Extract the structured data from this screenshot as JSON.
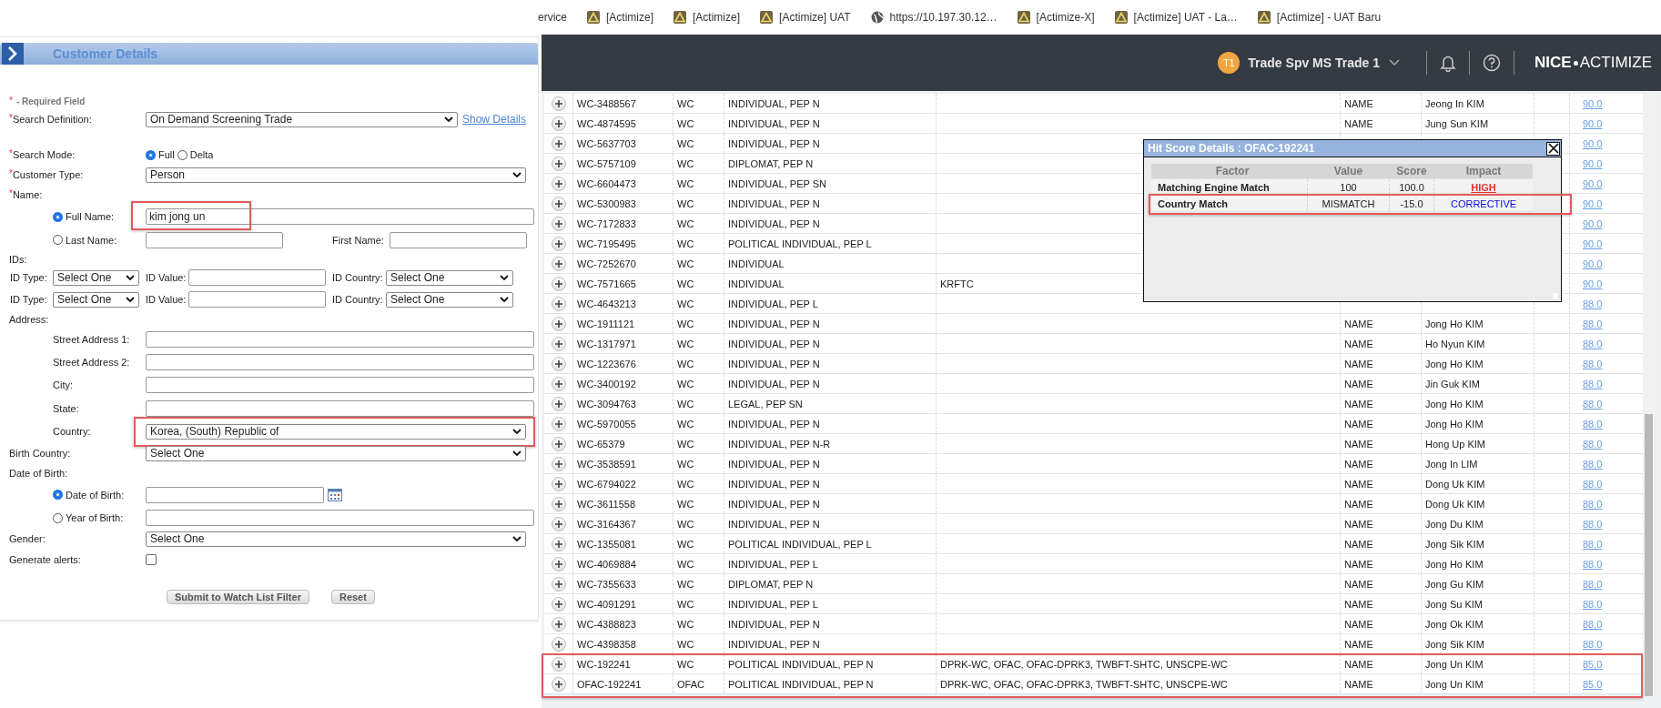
{
  "bookmarks": [
    {
      "label": "ervice"
    },
    {
      "label": "[Actimize]",
      "kind": "triangle"
    },
    {
      "label": "[Actimize]",
      "kind": "triangle"
    },
    {
      "label": "[Actimize] UAT",
      "kind": "triangle"
    },
    {
      "label": "https://10.197.30.12…",
      "kind": "globe"
    },
    {
      "label": "[Actimize-X]",
      "kind": "triangle"
    },
    {
      "label": "[Actimize] UAT - La…",
      "kind": "triangle"
    },
    {
      "label": "[Actimize] - UAT Baru",
      "kind": "triangle"
    }
  ],
  "app_bar": {
    "avatar": "T1",
    "user": "Trade Spv MS Trade 1",
    "logo": {
      "brand": "NICE",
      "product": "ACTIMIZE"
    }
  },
  "customer_details": {
    "title": "Customer Details",
    "required_note": {
      "mark": "*",
      "text": "- Required Field"
    },
    "search_definition": {
      "mark": "*",
      "label": "Search Definition:",
      "value": "On Demand Screening Trade",
      "link": "Show Details"
    },
    "search_mode": {
      "mark": "*",
      "label": "Search Mode:",
      "options": [
        {
          "label": "Full",
          "selected": true
        },
        {
          "label": "Delta",
          "selected": false
        }
      ]
    },
    "customer_type": {
      "mark": "*",
      "label": "Customer Type:",
      "value": "Person"
    },
    "name": {
      "mark": "*",
      "label": "Name:",
      "options": [
        {
          "label": "Full Name:",
          "selected": true,
          "value": "kim jong un",
          "highlighted": true
        },
        {
          "label": "Last Name:",
          "selected": false
        }
      ],
      "first_name": {
        "label": "First Name:"
      }
    },
    "ids": {
      "label": "IDs:",
      "rows": [
        {
          "type_label": "ID Type:",
          "type_value": "Select One",
          "value_label": "ID Value:",
          "country_label": "ID Country:",
          "country_value": "Select One"
        },
        {
          "type_label": "ID Type:",
          "type_value": "Select One",
          "value_label": "ID Value:",
          "country_label": "ID Country:",
          "country_value": "Select One"
        }
      ]
    },
    "address": {
      "label": "Address:",
      "fields": [
        {
          "label": "Street Address 1:",
          "kind": "text"
        },
        {
          "label": "Street Address 2:",
          "kind": "text"
        },
        {
          "label": "City:",
          "kind": "text"
        },
        {
          "label": "State:",
          "kind": "text"
        },
        {
          "label": "Country:",
          "kind": "select",
          "value": "Korea, (South) Republic of",
          "highlighted": true
        }
      ]
    },
    "birth_country": {
      "label": "Birth Country:",
      "value": "Select One"
    },
    "date_of_birth": {
      "label": "Date of Birth:",
      "options": [
        {
          "label": "Date of Birth:",
          "selected": true
        },
        {
          "label": "Year of Birth:",
          "selected": false
        }
      ]
    },
    "gender": {
      "label": "Gender:",
      "value": "Select One"
    },
    "generate_alerts": {
      "label": "Generate alerts:",
      "checked": false
    },
    "buttons": [
      "Submit to Watch List Filter",
      "Reset"
    ]
  },
  "table": {
    "rows": [
      {
        "column_1": "WC-3488567",
        "column_2": "WC",
        "column_3": "INDIVIDUAL, PEP N",
        "column_5": "NAME",
        "column_6": "Jeong In KIM",
        "column_8": "90.0",
        "highlighted": false
      },
      {
        "column_1": "WC-4874595",
        "column_2": "WC",
        "column_3": "INDIVIDUAL, PEP N",
        "column_5": "NAME",
        "column_6": "Jung Sun KIM",
        "column_8": "90.0",
        "highlighted": false
      },
      {
        "column_1": "WC-5637703",
        "column_2": "WC",
        "column_3": "INDIVIDUAL, PEP N",
        "column_8": "90.0",
        "highlighted": false
      },
      {
        "column_1": "WC-5757109",
        "column_2": "WC",
        "column_3": "DIPLOMAT, PEP N",
        "column_8": "90.0",
        "highlighted": false
      },
      {
        "column_1": "WC-6604473",
        "column_2": "WC",
        "column_3": "INDIVIDUAL, PEP SN",
        "column_8": "90.0",
        "highlighted": false
      },
      {
        "column_1": "WC-5300983",
        "column_2": "WC",
        "column_3": "INDIVIDUAL, PEP N",
        "column_8": "90.0",
        "highlighted": false
      },
      {
        "column_1": "WC-7172833",
        "column_2": "WC",
        "column_3": "INDIVIDUAL, PEP N",
        "column_8": "90.0",
        "highlighted": false
      },
      {
        "column_1": "WC-7195495",
        "column_2": "WC",
        "column_3": "POLITICAL INDIVIDUAL, PEP L",
        "column_8": "90.0",
        "highlighted": false
      },
      {
        "column_1": "WC-7252670",
        "column_2": "WC",
        "column_3": "INDIVIDUAL",
        "column_8": "90.0",
        "highlighted": false
      },
      {
        "column_1": "WC-7571665",
        "column_2": "WC",
        "column_3": "INDIVIDUAL",
        "column_4": "KRFTC",
        "column_8": "90.0",
        "highlighted": false
      },
      {
        "column_1": "WC-4643213",
        "column_2": "WC",
        "column_3": "INDIVIDUAL, PEP L",
        "column_8": "88.0",
        "highlighted": false
      },
      {
        "column_1": "WC-1911121",
        "column_2": "WC",
        "column_3": "INDIVIDUAL, PEP N",
        "column_5": "NAME",
        "column_6": "Jong Ho KIM",
        "column_8": "88.0",
        "highlighted": false
      },
      {
        "column_1": "WC-1317971",
        "column_2": "WC",
        "column_3": "INDIVIDUAL, PEP N",
        "column_5": "NAME",
        "column_6": "Ho Nyun KIM",
        "column_8": "88.0",
        "highlighted": false
      },
      {
        "column_1": "WC-1223676",
        "column_2": "WC",
        "column_3": "INDIVIDUAL, PEP N",
        "column_5": "NAME",
        "column_6": "Jong Ho KIM",
        "column_8": "88.0",
        "highlighted": false
      },
      {
        "column_1": "WC-3400192",
        "column_2": "WC",
        "column_3": "INDIVIDUAL, PEP N",
        "column_5": "NAME",
        "column_6": "Jin Guk KIM",
        "column_8": "88.0",
        "highlighted": false
      },
      {
        "column_1": "WC-3094763",
        "column_2": "WC",
        "column_3": "LEGAL, PEP SN",
        "column_5": "NAME",
        "column_6": "Jong Ho KIM",
        "column_8": "88.0",
        "highlighted": false
      },
      {
        "column_1": "WC-5970055",
        "column_2": "WC",
        "column_3": "INDIVIDUAL, PEP N",
        "column_5": "NAME",
        "column_6": "Jong Ho KIM",
        "column_8": "88.0",
        "highlighted": false
      },
      {
        "column_1": "WC-65379",
        "column_2": "WC",
        "column_3": "INDIVIDUAL, PEP N-R",
        "column_5": "NAME",
        "column_6": "Hong Up KIM",
        "column_8": "88.0",
        "highlighted": false
      },
      {
        "column_1": "WC-3538591",
        "column_2": "WC",
        "column_3": "INDIVIDUAL, PEP N",
        "column_5": "NAME",
        "column_6": "Jong In LIM",
        "column_8": "88.0",
        "highlighted": false
      },
      {
        "column_1": "WC-6794022",
        "column_2": "WC",
        "column_3": "INDIVIDUAL, PEP N",
        "column_5": "NAME",
        "column_6": "Dong Uk KIM",
        "column_8": "88.0",
        "highlighted": false
      },
      {
        "column_1": "WC-3611558",
        "column_2": "WC",
        "column_3": "INDIVIDUAL, PEP N",
        "column_5": "NAME",
        "column_6": "Dong Uk KIM",
        "column_8": "88.0",
        "highlighted": false
      },
      {
        "column_1": "WC-3164367",
        "column_2": "WC",
        "column_3": "INDIVIDUAL, PEP N",
        "column_5": "NAME",
        "column_6": "Jong Du KIM",
        "column_8": "88.0",
        "highlighted": false
      },
      {
        "column_1": "WC-1355081",
        "column_2": "WC",
        "column_3": "POLITICAL INDIVIDUAL, PEP L",
        "column_5": "NAME",
        "column_6": "Jong Sik KIM",
        "column_8": "88.0",
        "highlighted": false
      },
      {
        "column_1": "WC-4069884",
        "column_2": "WC",
        "column_3": "INDIVIDUAL, PEP L",
        "column_5": "NAME",
        "column_6": "Jong Ho KIM",
        "column_8": "88.0",
        "highlighted": false
      },
      {
        "column_1": "WC-7355633",
        "column_2": "WC",
        "column_3": "DIPLOMAT, PEP N",
        "column_5": "NAME",
        "column_6": "Jong Gu KIM",
        "column_8": "88.0",
        "highlighted": false
      },
      {
        "column_1": "WC-4091291",
        "column_2": "WC",
        "column_3": "INDIVIDUAL, PEP L",
        "column_5": "NAME",
        "column_6": "Jong Su KIM",
        "column_8": "88.0",
        "highlighted": false
      },
      {
        "column_1": "WC-4388823",
        "column_2": "WC",
        "column_3": "INDIVIDUAL, PEP N",
        "column_5": "NAME",
        "column_6": "Jong Ok KIM",
        "column_8": "88.0",
        "highlighted": false
      },
      {
        "column_1": "WC-4398358",
        "column_2": "WC",
        "column_3": "INDIVIDUAL, PEP N",
        "column_5": "NAME",
        "column_6": "Jong Sik KIM",
        "column_8": "88.0",
        "highlighted": false
      },
      {
        "column_1": "WC-192241",
        "column_2": "WC",
        "column_3": "POLITICAL INDIVIDUAL, PEP N",
        "column_4": "DPRK-WC, OFAC, OFAC-DPRK3, TWBFT-SHTC, UNSCPE-WC",
        "column_5": "NAME",
        "column_6": "Jong Un KIM",
        "column_8": "85.0",
        "highlighted": true
      },
      {
        "column_1": "OFAC-192241",
        "column_2": "OFAC",
        "column_3": "POLITICAL INDIVIDUAL, PEP N",
        "column_4": "DPRK-WC, OFAC, OFAC-DPRK3, TWBFT-SHTC, UNSCPE-WC",
        "column_5": "NAME",
        "column_6": "Jong Un KIM",
        "column_8": "85.0",
        "highlighted": true
      }
    ]
  },
  "popup": {
    "title": "Hit Score Details : OFAC-192241",
    "columns": [
      "Factor",
      "Value",
      "Score",
      "Impact"
    ],
    "rows": [
      {
        "factor": "Matching Engine Match",
        "value": "100",
        "score": "100.0",
        "impact": "HIGH",
        "color": "#e8302a",
        "link": true,
        "highlighted": false
      },
      {
        "factor": "Country Match",
        "value": "MISMATCH",
        "score": "-15.0",
        "impact": "CORRECTIVE",
        "color": "#0a0ae6",
        "link": false,
        "highlighted": true
      }
    ]
  }
}
